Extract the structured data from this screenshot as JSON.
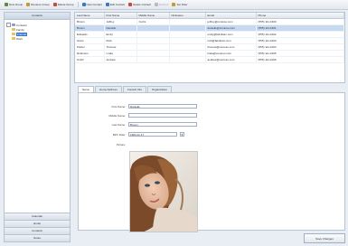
{
  "toolbar": {
    "buttons": [
      {
        "label": "New Group",
        "color": "#5a8c3a"
      },
      {
        "label": "Rename Group",
        "color": "#c89a2c"
      },
      {
        "label": "Delete Group",
        "color": "#c84a3a"
      },
      {
        "label": "New Contact",
        "color": "#3a78c8"
      },
      {
        "label": "Edit Contact",
        "color": "#3a78c8"
      },
      {
        "label": "Delete Contact",
        "color": "#c84a3a"
      },
      {
        "label": "Refresh",
        "color": "#888888"
      },
      {
        "label": "Set Filter",
        "color": "#c89a2c"
      }
    ]
  },
  "left": {
    "title": "Contacts",
    "tree": {
      "root": "Contacts",
      "items": [
        "Family",
        "Friends",
        "Work"
      ]
    },
    "bottom_tabs": [
      "Calendar",
      "Email",
      "Contacts",
      "Notes"
    ]
  },
  "grid": {
    "columns": [
      "Last Name",
      "First Name",
      "Middle Name",
      "Nickname",
      "Email",
      "Phone"
    ],
    "rows": [
      [
        "Brown",
        "Jeffrey",
        "Curtis",
        "",
        "jeffrey@contoso.com",
        "(555) 111-0100"
      ],
      [
        "Brown",
        "Danielle",
        "",
        "",
        "danielle@contoso.com",
        "(555) 111-0101"
      ],
      [
        "Edwards",
        "Emily",
        "",
        "",
        "emily@fabrikam.com",
        "(555) 111-0102"
      ],
      [
        "Grant",
        "Ruth",
        "",
        "",
        "ruth@fabrikam.com",
        "(555) 111-0103"
      ],
      [
        "Parker",
        "Thomas",
        "",
        "",
        "thomas@contoso.com",
        "(555) 111-0104"
      ],
      [
        "Robinson",
        "Linda",
        "",
        "",
        "linda@contoso.com",
        "(555) 111-0105"
      ],
      [
        "Smith",
        "Andrew",
        "",
        "",
        "andrew@contoso.com",
        "(555) 111-0106"
      ]
    ],
    "selected_index": 1
  },
  "tabs": [
    "Name",
    "Home Address",
    "Contact Info",
    "Organization"
  ],
  "form": {
    "first_name_label": "First Name:",
    "first_name": "Danielle",
    "middle_name_label": "Middle Name:",
    "middle_name": "",
    "last_name_label": "Last Name:",
    "last_name": "Brown",
    "birth_date_label": "Birth Date:",
    "birth_date": "1984-11-17",
    "picture_label": "Picture:"
  },
  "save_button": "Save Changes",
  "colors": {
    "selection": "#3b76c6",
    "row_selected": "#c7d9f0",
    "border": "#b9c4d2",
    "background": "#e9eef4"
  }
}
